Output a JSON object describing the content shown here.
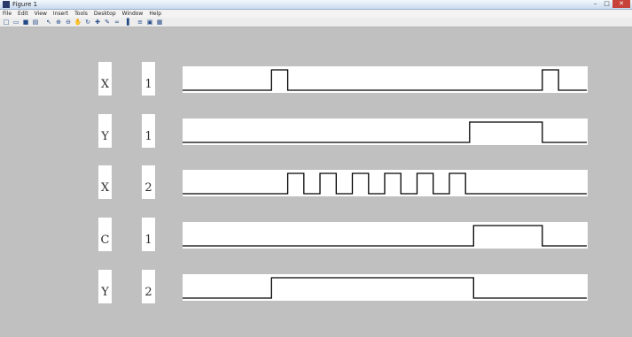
{
  "window": {
    "title": "Figure 1",
    "controls": [
      "–",
      "□",
      "✕"
    ]
  },
  "menu": [
    "File",
    "Edit",
    "View",
    "Insert",
    "Tools",
    "Desktop",
    "Window",
    "Help"
  ],
  "toolbar": [
    {
      "icon": "new-figure-icon",
      "glyph": "□"
    },
    {
      "icon": "open-file-icon",
      "glyph": "▭"
    },
    {
      "icon": "save-icon",
      "glyph": "■"
    },
    {
      "icon": "print-icon",
      "glyph": "▤"
    },
    {
      "icon": "edit-plot-icon",
      "glyph": "↖"
    },
    {
      "icon": "zoom-in-icon",
      "glyph": "⊕"
    },
    {
      "icon": "zoom-out-icon",
      "glyph": "⊖"
    },
    {
      "icon": "pan-icon",
      "glyph": "✋"
    },
    {
      "icon": "rotate-icon",
      "glyph": "↻"
    },
    {
      "icon": "data-cursor-icon",
      "glyph": "✚"
    },
    {
      "icon": "brush-icon",
      "glyph": "✎"
    },
    {
      "icon": "link-icon",
      "glyph": "∞"
    },
    {
      "icon": "colorbar-icon",
      "glyph": "▐"
    },
    {
      "icon": "legend-icon",
      "glyph": "≡"
    },
    {
      "icon": "hide-tools-icon",
      "glyph": "▣"
    },
    {
      "icon": "show-tools-icon",
      "glyph": "▦"
    }
  ],
  "signals": [
    {
      "name": "X",
      "index": "1"
    },
    {
      "name": "Y",
      "index": "1"
    },
    {
      "name": "X",
      "index": "2"
    },
    {
      "name": "C",
      "index": "1"
    },
    {
      "name": "Y",
      "index": "2"
    }
  ],
  "chart_data": {
    "type": "line",
    "x_range": [
      0,
      100
    ],
    "y_range": [
      0,
      1
    ],
    "grid": false,
    "series": [
      {
        "x": [
          0,
          22,
          22,
          26,
          26,
          89,
          89,
          93,
          93,
          100
        ],
        "y": [
          0,
          0,
          1,
          1,
          0,
          0,
          1,
          1,
          0,
          0
        ]
      },
      {
        "x": [
          0,
          71,
          71,
          89,
          89,
          100
        ],
        "y": [
          0,
          0,
          1,
          1,
          0,
          0
        ]
      },
      {
        "x": [
          0,
          26,
          26,
          30,
          30,
          34,
          34,
          38,
          38,
          42,
          42,
          46,
          46,
          50,
          50,
          54,
          54,
          58,
          58,
          62,
          62,
          66,
          66,
          70,
          70,
          74,
          74,
          100
        ],
        "y": [
          0,
          0,
          1,
          1,
          0,
          0,
          1,
          1,
          0,
          0,
          1,
          1,
          0,
          0,
          1,
          1,
          0,
          0,
          1,
          1,
          0,
          0,
          1,
          1,
          0,
          0,
          0,
          0
        ]
      },
      {
        "x": [
          0,
          72,
          72,
          89,
          89,
          100
        ],
        "y": [
          0,
          0,
          1,
          1,
          0,
          0
        ]
      },
      {
        "x": [
          0,
          22,
          22,
          72,
          72,
          100
        ],
        "y": [
          0,
          0,
          1,
          1,
          0,
          0
        ]
      }
    ]
  }
}
